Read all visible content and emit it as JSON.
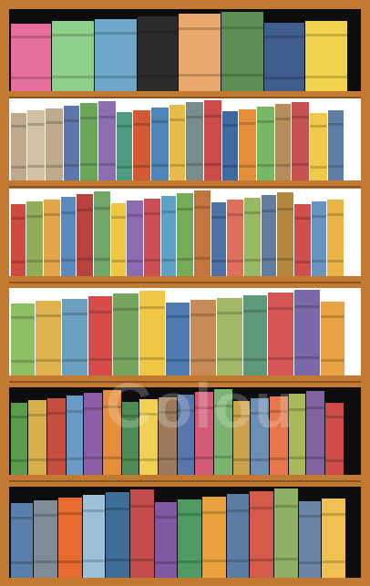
{
  "image": {
    "subject": "bookcase",
    "colors": {
      "frame": "#c27a32",
      "frame_dark": "#8a5220",
      "back_dark": "#0d0d0d",
      "back_light": "#ffffff"
    }
  },
  "watermark": {
    "text": "Colou"
  },
  "shelves": [
    {
      "name": "shelf-1",
      "back": "dark",
      "books": [
        [
          "#e66f9b",
          1
        ],
        [
          "#8fcf8c",
          1
        ],
        [
          "#6fa7cc",
          1
        ],
        [
          "#2b2b2b",
          0
        ],
        [
          "#e9a86c",
          1
        ],
        [
          "#5d8f54",
          1
        ],
        [
          "#3f5e8e",
          1
        ],
        [
          "#f1d34e",
          1
        ]
      ]
    },
    {
      "name": "shelf-2",
      "back": "light",
      "books": [
        [
          "#bda98b",
          1
        ],
        [
          "#d1c0a2",
          1
        ],
        [
          "#bda98b",
          1
        ],
        [
          "#5d78a8",
          1
        ],
        [
          "#6aa55a",
          1
        ],
        [
          "#8b6fb1",
          1
        ],
        [
          "#4f9b83",
          1
        ],
        [
          "#d45a35",
          1
        ],
        [
          "#4e86b8",
          1
        ],
        [
          "#e7bb4a",
          1
        ],
        [
          "#7a8b8b",
          1
        ],
        [
          "#cc4a4a",
          1
        ],
        [
          "#3d6aa0",
          1
        ],
        [
          "#e28e3b",
          1
        ],
        [
          "#76b868",
          1
        ],
        [
          "#b78c5d",
          1
        ],
        [
          "#c75252",
          1
        ],
        [
          "#f0c94a",
          1
        ],
        [
          "#5e7ea6",
          1
        ]
      ]
    },
    {
      "name": "shelf-3",
      "back": "light",
      "books": [
        [
          "#cc4a3f",
          1
        ],
        [
          "#8fae57",
          1
        ],
        [
          "#e3a64a",
          1
        ],
        [
          "#5b8abf",
          1
        ],
        [
          "#b9423e",
          1
        ],
        [
          "#72a76a",
          1
        ],
        [
          "#f0c541",
          1
        ],
        [
          "#8e6bb0",
          1
        ],
        [
          "#cc4e55",
          1
        ],
        [
          "#5fa0c8",
          1
        ],
        [
          "#76ab5a",
          1
        ],
        [
          "#c2763e",
          1
        ],
        [
          "#4e72a8",
          1
        ],
        [
          "#de6f5a",
          1
        ],
        [
          "#97b865",
          1
        ],
        [
          "#627d9d",
          1
        ],
        [
          "#b3883d",
          1
        ],
        [
          "#d14e4e",
          1
        ],
        [
          "#6795bf",
          1
        ],
        [
          "#e8b446",
          1
        ]
      ]
    },
    {
      "name": "shelf-4",
      "back": "light",
      "books": [
        [
          "#8ebf64",
          1
        ],
        [
          "#e0b350",
          1
        ],
        [
          "#6ba0c0",
          1
        ],
        [
          "#d64c4c",
          1
        ],
        [
          "#76a35d",
          1
        ],
        [
          "#f0c645",
          1
        ],
        [
          "#4f7bb0",
          1
        ],
        [
          "#c88a57",
          1
        ],
        [
          "#a0b868",
          1
        ],
        [
          "#5d9a79",
          1
        ],
        [
          "#d65656",
          1
        ],
        [
          "#7a68a8",
          1
        ],
        [
          "#e7a243",
          1
        ]
      ]
    },
    {
      "name": "shelf-5",
      "back": "dark",
      "books": [
        [
          "#5a9c4b",
          1
        ],
        [
          "#d6b04a",
          1
        ],
        [
          "#c64e3f",
          1
        ],
        [
          "#6a9bc6",
          1
        ],
        [
          "#8c5ea6",
          1
        ],
        [
          "#e58d3a",
          1
        ],
        [
          "#4e8a55",
          1
        ],
        [
          "#f0d154",
          1
        ],
        [
          "#9a7a5b",
          1
        ],
        [
          "#5777a8",
          1
        ],
        [
          "#d45b75",
          1
        ],
        [
          "#7bb370",
          1
        ],
        [
          "#c9a24a",
          1
        ],
        [
          "#6d8fb5",
          1
        ],
        [
          "#e6764c",
          1
        ],
        [
          "#a7b957",
          1
        ],
        [
          "#8163a2",
          1
        ],
        [
          "#cf4a4a",
          1
        ]
      ]
    },
    {
      "name": "shelf-6",
      "back": "dark",
      "books": [
        [
          "#5a7fa8",
          1
        ],
        [
          "#7d8c96",
          1
        ],
        [
          "#e76a2f",
          1
        ],
        [
          "#9cc1d8",
          1
        ],
        [
          "#3e6d97",
          1
        ],
        [
          "#c44b4b",
          1
        ],
        [
          "#7e5aa4",
          1
        ],
        [
          "#4f9a62",
          1
        ],
        [
          "#e8a13b",
          1
        ],
        [
          "#5c7da3",
          1
        ],
        [
          "#d45a4a",
          1
        ],
        [
          "#8eb062",
          1
        ],
        [
          "#6c84a5",
          1
        ],
        [
          "#f0c150",
          1
        ]
      ]
    }
  ]
}
